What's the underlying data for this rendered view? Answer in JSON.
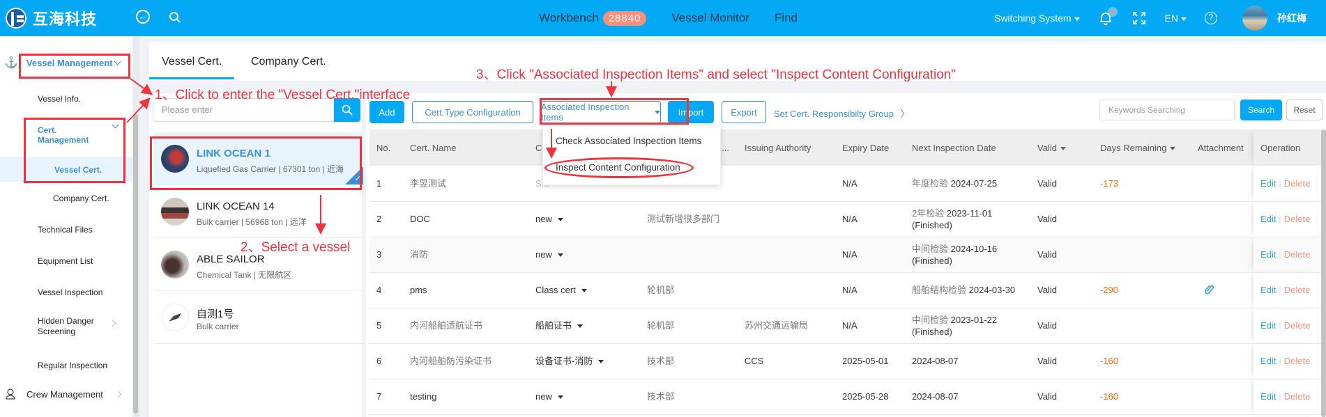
{
  "topbar": {
    "brand": "互海科技",
    "nav": [
      {
        "label": "Workbench",
        "badge": "28840"
      },
      {
        "label": "Vessel Monitor"
      },
      {
        "label": "Find"
      }
    ],
    "switch_system": "Switching System",
    "language": "EN",
    "help_glyph": "?",
    "username": "孙红梅",
    "icons": [
      "back-icon",
      "search-icon",
      "bell-icon",
      "fullscreen-icon",
      "help-icon"
    ]
  },
  "sidebar": {
    "vessel_management": "Vessel Management",
    "items": [
      {
        "label": "Vessel Info."
      },
      {
        "label": "Cert. Management"
      },
      {
        "label": "Vessel Cert."
      },
      {
        "label": "Company Cert."
      },
      {
        "label": "Technical Files"
      },
      {
        "label": "Equipment List"
      },
      {
        "label": "Vessel Inspection"
      },
      {
        "label": "Hidden Danger Screening"
      },
      {
        "label": "Regular Inspection"
      }
    ],
    "crew_management": "Crew Management"
  },
  "tabs": [
    {
      "label": "Vessel Cert.",
      "active": true
    },
    {
      "label": "Company Cert."
    }
  ],
  "vessel_search": {
    "placeholder": "Please enter"
  },
  "vessels": [
    {
      "name": "LINK OCEAN 1",
      "sub": "Liquefied Gas Carrier | 67301 ton | 近海",
      "selected": true
    },
    {
      "name": "LINK OCEAN 14",
      "sub": "Bulk carrier | 56968 ton | 远洋"
    },
    {
      "name": "ABLE SAILOR",
      "sub": "Chemical Tank | 无限航区"
    },
    {
      "name": "自测1号",
      "sub": "Bulk carrier"
    }
  ],
  "toolbar": {
    "add": "Add",
    "cert_type_config": "Cert.Type Configuration",
    "associated_items": "Associated Inspection Items",
    "import": "Import",
    "export": "Export",
    "responsibility_group": "Set Cert. Responsibilty Group",
    "keywords_placeholder": "Keywords Searching",
    "search": "Search",
    "reset": "Reset"
  },
  "dropdown": {
    "items": [
      "Check Associated Inspection Items",
      "Inspect Content Configuration"
    ]
  },
  "table": {
    "headers": [
      "No.",
      "Cert. Name",
      "C",
      "...",
      "Issuing Authority",
      "Expiry Date",
      "Next Inspection Date",
      "Valid",
      "Days Remaining",
      "Attachment",
      "Operation"
    ],
    "rows": [
      {
        "no": "1",
        "name": "李昱测试",
        "type": "S...",
        "dept": "",
        "authority": "",
        "expiry": "N/A",
        "next_prefix": "年度检验",
        "next_date": "2024-07-25",
        "next_status": "",
        "valid": "Valid",
        "days": "-173",
        "attachment": false
      },
      {
        "no": "2",
        "name": "DOC",
        "type": "new",
        "dept": "测试新增很多部门",
        "authority": "",
        "expiry": "N/A",
        "next_prefix": "2年检验",
        "next_date": "2023-11-01",
        "next_status": "(Finished)",
        "valid": "Valid",
        "days": "",
        "attachment": false
      },
      {
        "no": "3",
        "name": "消防",
        "type": "new",
        "dept": "",
        "authority": "",
        "expiry": "N/A",
        "next_prefix": "中间检验",
        "next_date": "2024-10-16",
        "next_status": "(Finished)",
        "valid": "Valid",
        "days": "",
        "attachment": false
      },
      {
        "no": "4",
        "name": "pms",
        "type": "Class cert",
        "dept": "轮机部",
        "authority": "",
        "expiry": "N/A",
        "next_prefix": "船舶结构检验",
        "next_date": "2024-03-30",
        "next_status": "",
        "valid": "Valid",
        "days": "-290",
        "attachment": true
      },
      {
        "no": "5",
        "name": "内河船舶适航证书",
        "type": "船舶证书",
        "dept": "轮机部",
        "authority": "苏州交通运输局",
        "expiry": "N/A",
        "next_prefix": "中间检验",
        "next_date": "2023-01-22",
        "next_status": "(Finished)",
        "valid": "Valid",
        "days": "",
        "attachment": false
      },
      {
        "no": "6",
        "name": "内河船舶防污染证书",
        "type": "设备证书-消防",
        "dept": "技术部",
        "authority": "CCS",
        "expiry": "2025-05-01",
        "next_prefix": "",
        "next_date": "2024-08-07",
        "next_status": "",
        "valid": "Valid",
        "days": "-160",
        "attachment": false
      },
      {
        "no": "7",
        "name": "testing",
        "type": "new",
        "dept": "技术部",
        "authority": "",
        "expiry": "2025-05-28",
        "next_prefix": "",
        "next_date": "2024-08-07",
        "next_status": "",
        "valid": "Valid",
        "days": "-160",
        "attachment": false
      }
    ],
    "edit": "Edit",
    "delete": "Delete"
  },
  "annotations": {
    "step1": "1、Click to enter the \"Vessel Cert.\"interface",
    "step2": "2、Select a vessel",
    "step3": "3、Click \"Associated Inspection Items\" and select \"Inspect Content Configuration\""
  },
  "colors": {
    "primary": "#03a9f4",
    "link": "#3b8fd9",
    "annotation": "#f0323c",
    "negative": "#ff6a00",
    "delete": "#f9907a",
    "badge": "#f9907a"
  }
}
